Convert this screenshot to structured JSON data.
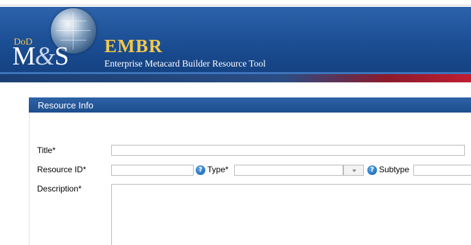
{
  "header": {
    "logo": {
      "dod": "DoD",
      "m": "M",
      "amp": "&",
      "s": "S"
    },
    "title": "EMBR",
    "subtitle": "Enterprise Metacard Builder Resource Tool"
  },
  "panel": {
    "title": "Resource Info"
  },
  "form": {
    "title_label": "Title*",
    "title_value": "",
    "resource_id_label": "Resource ID*",
    "resource_id_value": "",
    "type_label": "Type*",
    "type_value": "",
    "subtype_label": "Subtype",
    "subtype_value": "",
    "description_label": "Description*",
    "description_value": "",
    "help_glyph": "?"
  },
  "colors": {
    "banner_blue": "#1c4f95",
    "title_gold": "#f2c94c",
    "panel_header": "#1d4e8e",
    "help_icon": "#2b7ac6"
  },
  "icons": [
    "globe-logo",
    "help-icon",
    "chevron-down-icon"
  ]
}
